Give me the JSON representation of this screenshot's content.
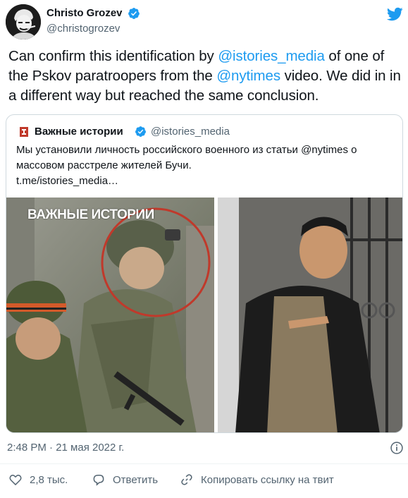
{
  "author": {
    "display_name": "Christo Grozev",
    "handle": "@christogrozev",
    "avatar_icon": "avatar-portrait-icon",
    "verified_icon": "verified-badge-icon"
  },
  "brand_icon": "twitter-bird-icon",
  "tweet": {
    "segments": [
      {
        "text": "Can confirm this identification by ",
        "type": "text"
      },
      {
        "text": "@istories_media",
        "type": "mention"
      },
      {
        "text": " of one of the Pskov paratroopers from the ",
        "type": "text"
      },
      {
        "text": "@nytimes",
        "type": "mention"
      },
      {
        "text": " video. We did in in a different way but reached the same conclusion.",
        "type": "text"
      }
    ]
  },
  "quoted": {
    "display_name": "Важные истории",
    "handle": "@istories_media",
    "text": "Мы установили личность российского военного из статьи @nytimes о массовом расстреле жителей Бучи.",
    "link": "t.me/istories_media…",
    "media": {
      "watermark": "ВАЖНЫЕ ИСТОРИИ"
    }
  },
  "meta": {
    "timestamp": "2:48 PM · 21 мая 2022 г."
  },
  "actions": {
    "like_count": "2,8 тыс.",
    "reply_label": "Ответить",
    "copy_link_label": "Копировать ссылку на твит"
  },
  "colors": {
    "accent": "#1d9bf0",
    "muted": "#536471",
    "border": "#cfd9de"
  }
}
